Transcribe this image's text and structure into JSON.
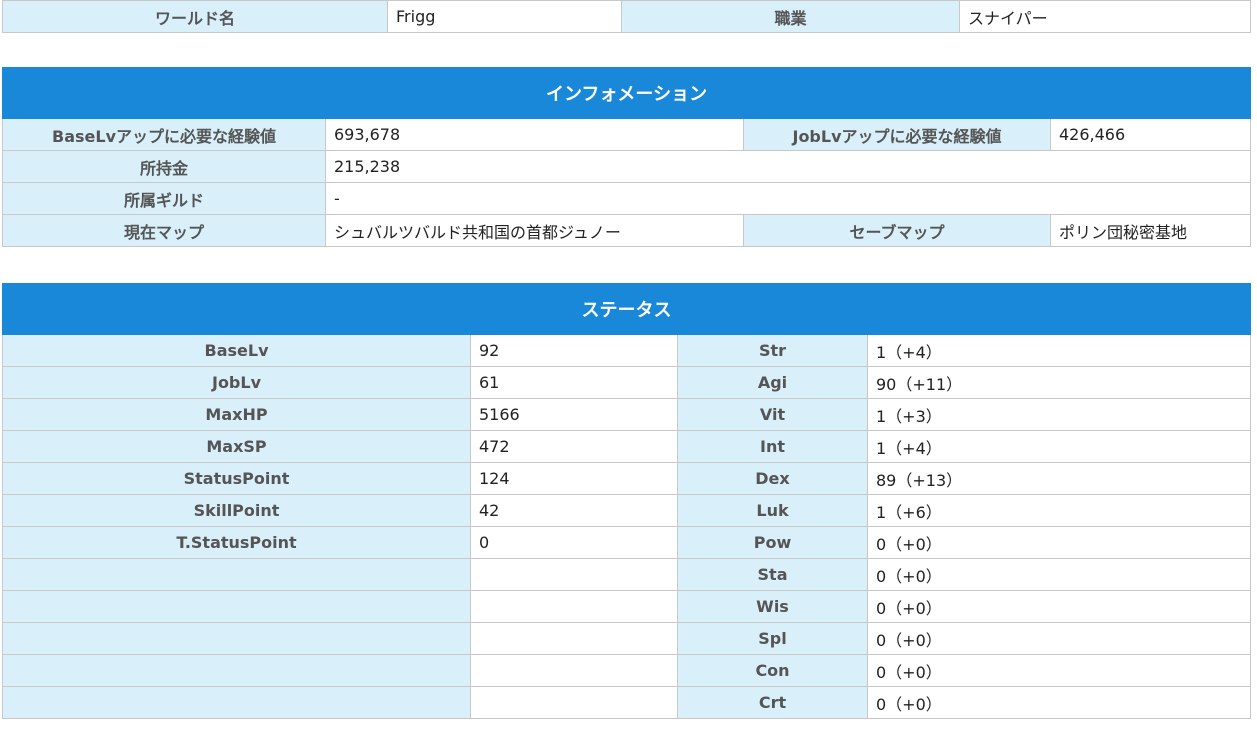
{
  "world": {
    "world_name_label": "ワールド名",
    "world_name_value": "Frigg",
    "job_label": "職業",
    "job_value": "スナイパー"
  },
  "info": {
    "title": "インフォメーション",
    "base_exp_label": "BaseLvアップに必要な経験値",
    "base_exp_value": "693,678",
    "job_exp_label": "JobLvアップに必要な経験値",
    "job_exp_value": "426,466",
    "zeny_label": "所持金",
    "zeny_value": "215,238",
    "guild_label": "所属ギルド",
    "guild_value": "-",
    "current_map_label": "現在マップ",
    "current_map_value": "シュバルツバルド共和国の首都ジュノー",
    "save_map_label": "セーブマップ",
    "save_map_value": "ポリン団秘密基地"
  },
  "status": {
    "title": "ステータス",
    "left_rows": [
      {
        "label": "BaseLv",
        "value": "92"
      },
      {
        "label": "JobLv",
        "value": "61"
      },
      {
        "label": "MaxHP",
        "value": "5166"
      },
      {
        "label": "MaxSP",
        "value": "472"
      },
      {
        "label": "StatusPoint",
        "value": "124"
      },
      {
        "label": "SkillPoint",
        "value": "42"
      },
      {
        "label": "T.StatusPoint",
        "value": "0"
      },
      {
        "label": "",
        "value": ""
      },
      {
        "label": "",
        "value": ""
      },
      {
        "label": "",
        "value": ""
      },
      {
        "label": "",
        "value": ""
      },
      {
        "label": "",
        "value": ""
      }
    ],
    "right_rows": [
      {
        "label": "Str",
        "value": "1（+4）"
      },
      {
        "label": "Agi",
        "value": "90（+11）"
      },
      {
        "label": "Vit",
        "value": "1（+3）"
      },
      {
        "label": "Int",
        "value": "1（+4）"
      },
      {
        "label": "Dex",
        "value": "89（+13）"
      },
      {
        "label": "Luk",
        "value": "1（+6）"
      },
      {
        "label": "Pow",
        "value": "0（+0）"
      },
      {
        "label": "Sta",
        "value": "0（+0）"
      },
      {
        "label": "Wis",
        "value": "0（+0）"
      },
      {
        "label": "Spl",
        "value": "0（+0）"
      },
      {
        "label": "Con",
        "value": "0（+0）"
      },
      {
        "label": "Crt",
        "value": "0（+0）"
      }
    ]
  }
}
